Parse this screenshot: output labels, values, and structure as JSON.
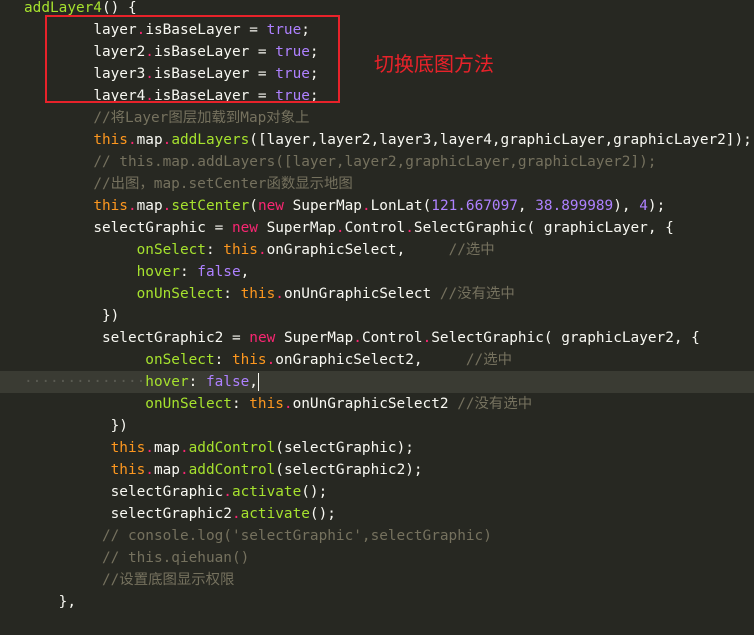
{
  "annotation": {
    "text": "切换底图方法",
    "color": "#e8222a"
  },
  "colors": {
    "background": "#272822",
    "keyword": "#f92672",
    "this": "#fd971f",
    "constant": "#ae81ff",
    "function": "#a6e22e",
    "comment": "#75715e",
    "text": "#f8f8f2"
  },
  "code_lines": [
    {
      "indent": "",
      "tokens": [
        [
          "func",
          "addLayer4"
        ],
        [
          "punct",
          "() {"
        ]
      ]
    },
    {
      "indent": "        ",
      "tokens": [
        [
          "plain",
          "layer"
        ],
        [
          "dot",
          "."
        ],
        [
          "plain",
          "isBaseLayer = "
        ],
        [
          "const",
          "true"
        ],
        [
          "punct",
          ";"
        ]
      ]
    },
    {
      "indent": "        ",
      "tokens": [
        [
          "plain",
          "layer2"
        ],
        [
          "dot",
          "."
        ],
        [
          "plain",
          "isBaseLayer = "
        ],
        [
          "const",
          "true"
        ],
        [
          "punct",
          ";"
        ]
      ]
    },
    {
      "indent": "        ",
      "tokens": [
        [
          "plain",
          "layer3"
        ],
        [
          "dot",
          "."
        ],
        [
          "plain",
          "isBaseLayer = "
        ],
        [
          "const",
          "true"
        ],
        [
          "punct",
          ";"
        ]
      ]
    },
    {
      "indent": "        ",
      "tokens": [
        [
          "plain",
          "layer4"
        ],
        [
          "dot",
          "."
        ],
        [
          "plain",
          "isBaseLayer = "
        ],
        [
          "const",
          "true"
        ],
        [
          "punct",
          ";"
        ]
      ]
    },
    {
      "indent": "        ",
      "tokens": [
        [
          "comment",
          "//将Layer图层加载到Map对象上"
        ]
      ]
    },
    {
      "indent": "        ",
      "tokens": [
        [
          "this",
          "this"
        ],
        [
          "dot",
          "."
        ],
        [
          "plain",
          "map"
        ],
        [
          "dot",
          "."
        ],
        [
          "func",
          "addLayers"
        ],
        [
          "punct",
          "([layer,layer2,layer3,layer4,graphicLayer,graphicLayer2]);"
        ]
      ]
    },
    {
      "indent": "        ",
      "tokens": [
        [
          "comment",
          "// this.map.addLayers([layer,layer2,graphicLayer,graphicLayer2]);"
        ]
      ]
    },
    {
      "indent": "        ",
      "tokens": [
        [
          "comment",
          "//出图，map.setCenter函数显示地图"
        ]
      ]
    },
    {
      "indent": "        ",
      "tokens": [
        [
          "this",
          "this"
        ],
        [
          "dot",
          "."
        ],
        [
          "plain",
          "map"
        ],
        [
          "dot",
          "."
        ],
        [
          "func",
          "setCenter"
        ],
        [
          "punct",
          "("
        ],
        [
          "keyword",
          "new"
        ],
        [
          "plain",
          " SuperMap"
        ],
        [
          "dot",
          "."
        ],
        [
          "plain",
          "LonLat("
        ],
        [
          "const",
          "121.667097"
        ],
        [
          "punct",
          ", "
        ],
        [
          "const",
          "38.899989"
        ],
        [
          "punct",
          "), "
        ],
        [
          "const",
          "4"
        ],
        [
          "punct",
          ");"
        ]
      ]
    },
    {
      "indent": "        ",
      "tokens": [
        [
          "plain",
          "selectGraphic = "
        ],
        [
          "keyword",
          "new"
        ],
        [
          "plain",
          " SuperMap"
        ],
        [
          "dot",
          "."
        ],
        [
          "plain",
          "Control"
        ],
        [
          "dot",
          "."
        ],
        [
          "plain",
          "SelectGraphic( graphicLayer, {"
        ]
      ]
    },
    {
      "indent": "             ",
      "tokens": [
        [
          "func",
          "onSelect"
        ],
        [
          "punct",
          ": "
        ],
        [
          "this",
          "this"
        ],
        [
          "dot",
          "."
        ],
        [
          "plain",
          "onGraphicSelect,     "
        ],
        [
          "comment",
          "//选中"
        ]
      ]
    },
    {
      "indent": "             ",
      "tokens": [
        [
          "func",
          "hover"
        ],
        [
          "punct",
          ": "
        ],
        [
          "const",
          "false"
        ],
        [
          "punct",
          ","
        ]
      ]
    },
    {
      "indent": "             ",
      "tokens": [
        [
          "func",
          "onUnSelect"
        ],
        [
          "punct",
          ": "
        ],
        [
          "this",
          "this"
        ],
        [
          "dot",
          "."
        ],
        [
          "plain",
          "onUnGraphicSelect "
        ],
        [
          "comment",
          "//没有选中"
        ]
      ]
    },
    {
      "indent": "         ",
      "tokens": [
        [
          "punct",
          "})"
        ]
      ]
    },
    {
      "indent": "         ",
      "tokens": [
        [
          "plain",
          "selectGraphic2 = "
        ],
        [
          "keyword",
          "new"
        ],
        [
          "plain",
          " SuperMap"
        ],
        [
          "dot",
          "."
        ],
        [
          "plain",
          "Control"
        ],
        [
          "dot",
          "."
        ],
        [
          "plain",
          "SelectGraphic( graphicLayer2, {"
        ]
      ]
    },
    {
      "indent": "              ",
      "tokens": [
        [
          "func",
          "onSelect"
        ],
        [
          "punct",
          ": "
        ],
        [
          "this",
          "this"
        ],
        [
          "dot",
          "."
        ],
        [
          "plain",
          "onGraphicSelect2,     "
        ],
        [
          "comment",
          "//选中"
        ]
      ]
    },
    {
      "indent": "··············",
      "current": true,
      "tokens": [
        [
          "func",
          "hover"
        ],
        [
          "punct",
          ": "
        ],
        [
          "const",
          "false"
        ],
        [
          "punct",
          ","
        ]
      ]
    },
    {
      "indent": "              ",
      "tokens": [
        [
          "func",
          "onUnSelect"
        ],
        [
          "punct",
          ": "
        ],
        [
          "this",
          "this"
        ],
        [
          "dot",
          "."
        ],
        [
          "plain",
          "onUnGraphicSelect2 "
        ],
        [
          "comment",
          "//没有选中"
        ]
      ]
    },
    {
      "indent": "          ",
      "tokens": [
        [
          "punct",
          "})"
        ]
      ]
    },
    {
      "indent": "          ",
      "tokens": [
        [
          "this",
          "this"
        ],
        [
          "dot",
          "."
        ],
        [
          "plain",
          "map"
        ],
        [
          "dot",
          "."
        ],
        [
          "func",
          "addControl"
        ],
        [
          "punct",
          "(selectGraphic);"
        ]
      ]
    },
    {
      "indent": "          ",
      "tokens": [
        [
          "this",
          "this"
        ],
        [
          "dot",
          "."
        ],
        [
          "plain",
          "map"
        ],
        [
          "dot",
          "."
        ],
        [
          "func",
          "addControl"
        ],
        [
          "punct",
          "(selectGraphic2);"
        ]
      ]
    },
    {
      "indent": "          ",
      "tokens": [
        [
          "plain",
          "selectGraphic"
        ],
        [
          "dot",
          "."
        ],
        [
          "func",
          "activate"
        ],
        [
          "punct",
          "();"
        ]
      ]
    },
    {
      "indent": "          ",
      "tokens": [
        [
          "plain",
          "selectGraphic2"
        ],
        [
          "dot",
          "."
        ],
        [
          "func",
          "activate"
        ],
        [
          "punct",
          "();"
        ]
      ]
    },
    {
      "indent": "         ",
      "tokens": [
        [
          "comment",
          "// console.log('selectGraphic',selectGraphic)"
        ]
      ]
    },
    {
      "indent": "         ",
      "tokens": [
        [
          "comment",
          "// this.qiehuan()"
        ]
      ]
    },
    {
      "indent": "         ",
      "tokens": [
        [
          "comment",
          "//设置底图显示权限"
        ]
      ]
    },
    {
      "indent": "    ",
      "tokens": [
        [
          "punct",
          "},"
        ]
      ]
    },
    {
      "indent": "",
      "tokens": []
    }
  ]
}
